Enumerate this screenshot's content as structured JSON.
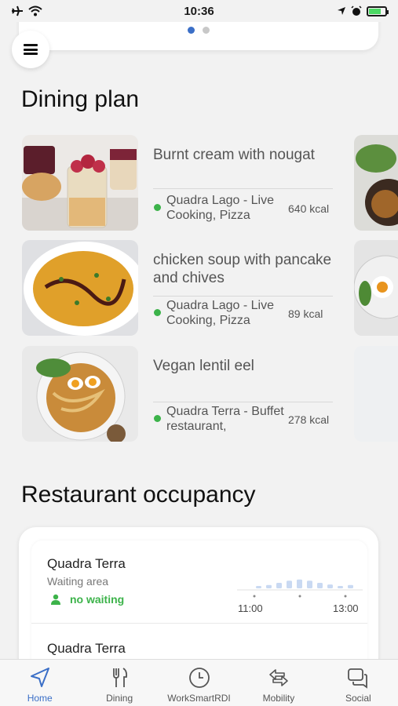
{
  "status": {
    "time": "10:36"
  },
  "dining": {
    "title": "Dining plan",
    "items": [
      {
        "name": "Burnt cream with nougat",
        "location": "Quadra Lago - Live Cooking, Pizza",
        "kcal": "640 kcal"
      },
      {
        "name": "chicken soup with pancake and chives",
        "location": "Quadra Lago - Live Cooking, Pizza",
        "kcal": "89 kcal"
      },
      {
        "name": "Vegan lentil eel",
        "location": "Quadra Terra - Buffet restaurant,",
        "kcal": "278 kcal"
      }
    ]
  },
  "occupancy": {
    "title": "Restaurant occupancy",
    "entries": [
      {
        "name": "Quadra Terra",
        "area": "Waiting area",
        "status": "no waiting",
        "start_time": "11:00",
        "end_time": "13:00"
      },
      {
        "name": "Quadra Terra"
      }
    ],
    "forecast": [
      0.2,
      0.3,
      0.5,
      0.7,
      0.8,
      0.7,
      0.5,
      0.35,
      0.2,
      0.3
    ]
  },
  "tabs": [
    {
      "label": "Home",
      "icon": "navigation-arrow-icon",
      "active": true
    },
    {
      "label": "Dining",
      "icon": "fork-knife-icon"
    },
    {
      "label": "WorkSmartRDI",
      "icon": "clock-icon"
    },
    {
      "label": "Mobility",
      "icon": "arrows-left-right-icon"
    },
    {
      "label": "Social",
      "icon": "chat-bubbles-icon"
    }
  ],
  "colors": {
    "accent": "#3b6fc7",
    "status_green": "#3cb34a"
  }
}
